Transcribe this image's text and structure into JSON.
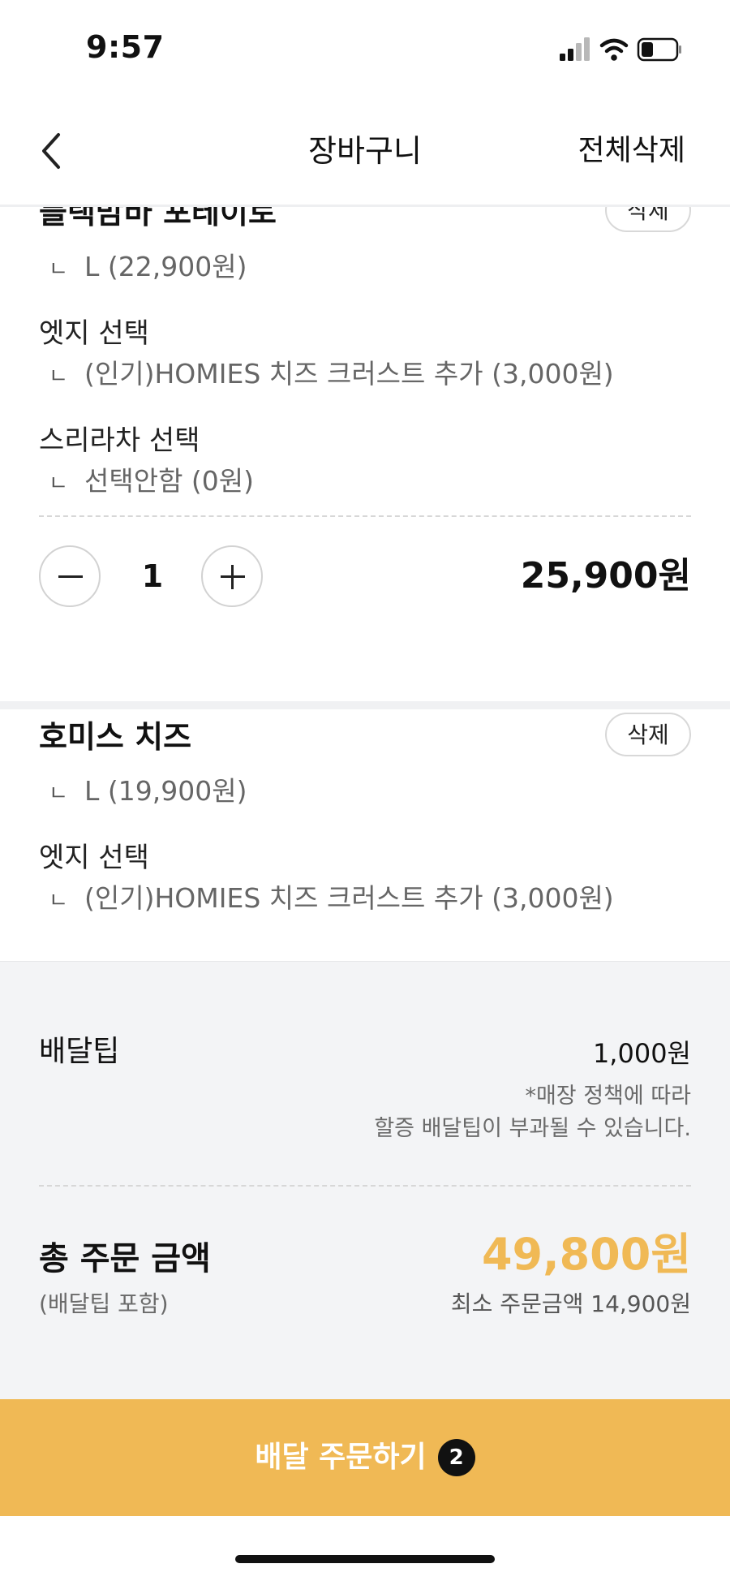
{
  "status_bar": {
    "time": "9:57",
    "icons": [
      "cellular-signal-icon",
      "wifi-icon",
      "battery-icon"
    ]
  },
  "header": {
    "back_icon": "chevron-left-icon",
    "title": "장바구니",
    "delete_all_label": "전체삭제"
  },
  "cart_items": [
    {
      "name": "블랙맘바 포테이토",
      "delete_label": "삭제",
      "size_option": "L (22,900원)",
      "option_groups": [
        {
          "title": "엣지 선택",
          "value": "(인기)HOMIES 치즈 크러스트 추가 (3,000원)"
        },
        {
          "title": "스리라차 선택",
          "value": "선택안함 (0원)"
        }
      ],
      "quantity": "1",
      "price": "25,900원"
    },
    {
      "name": "호미스 치즈",
      "delete_label": "삭제",
      "size_option": "L (19,900원)",
      "option_groups": [
        {
          "title": "엣지 선택",
          "value": "(인기)HOMIES 치즈 크러스트 추가 (3,000원)"
        }
      ]
    }
  ],
  "summary": {
    "delivery_tip_label": "배달팁",
    "delivery_tip_value": "1,000원",
    "delivery_tip_note_line1": "*매장 정책에 따라",
    "delivery_tip_note_line2": "할증 배달팁이 부과될 수 있습니다.",
    "total_label": "총 주문 금액",
    "total_sublabel": "(배달팁 포함)",
    "total_amount": "49,800원",
    "min_order": "최소 주문금액 14,900원"
  },
  "order_button": {
    "label": "배달 주문하기",
    "badge_count": "2"
  },
  "colors": {
    "accent": "#F0B955",
    "total_amount": "#F0B955",
    "text_primary": "#111111",
    "text_secondary": "#666666",
    "summary_bg": "#F3F4F6"
  },
  "option_prefix_glyph": "ㄴ"
}
